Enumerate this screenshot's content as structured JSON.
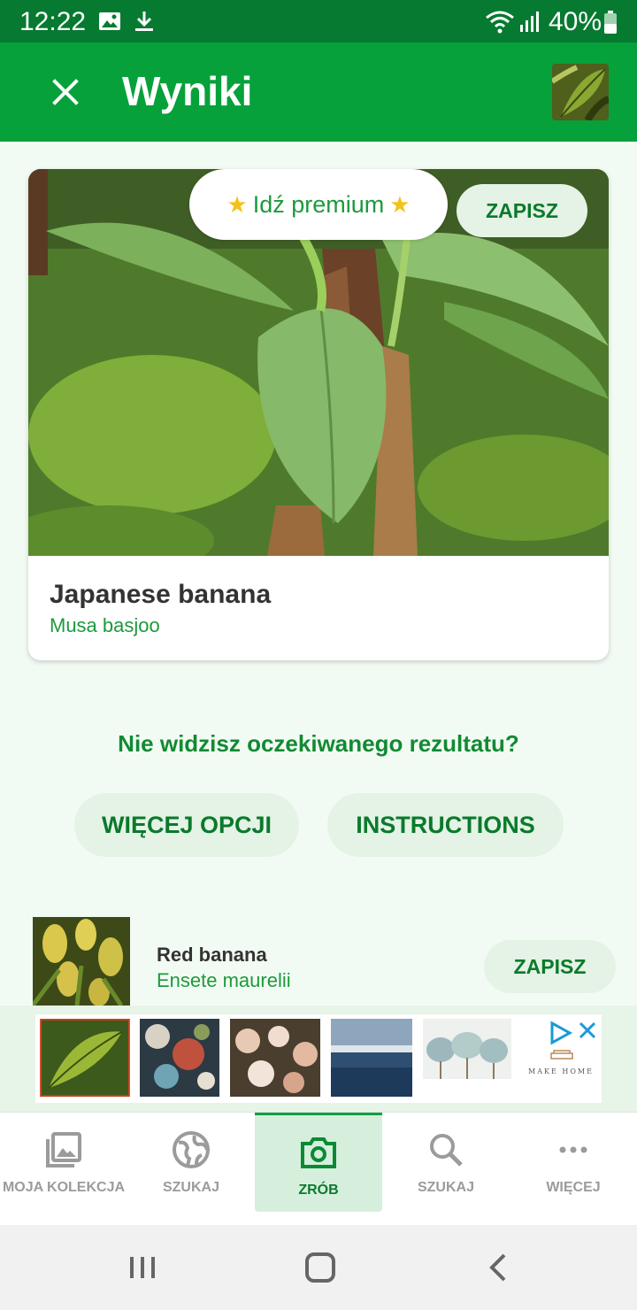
{
  "status_bar": {
    "time": "12:22",
    "battery": "40%"
  },
  "app_bar": {
    "title": "Wyniki"
  },
  "main_result": {
    "premium_label": "Idź premium",
    "save_label": "ZAPISZ",
    "common_name": "Japanese banana",
    "latin_name": "Musa basjoo"
  },
  "not_found": {
    "question": "Nie widzisz oczekiwanego rezultatu?",
    "more_options_label": "WIĘCEJ OPCJI",
    "instructions_label": "INSTRUCTIONS"
  },
  "second_result": {
    "common_name": "Red banana",
    "latin_name": "Ensete maurelii",
    "save_label": "ZAPISZ"
  },
  "ad": {
    "brand": "MAKE HOME"
  },
  "bottom_nav": {
    "items": [
      {
        "label": "MOJA KOLEKCJA",
        "icon": "collection-icon"
      },
      {
        "label": "SZUKAJ",
        "icon": "globe-icon"
      },
      {
        "label": "ZRÓB",
        "icon": "camera-icon"
      },
      {
        "label": "SZUKAJ",
        "icon": "search-icon"
      },
      {
        "label": "WIĘCEJ",
        "icon": "more-icon"
      }
    ],
    "active_index": 2
  },
  "colors": {
    "status_bar": "#067a30",
    "app_bar": "#06a13a",
    "accent_text": "#1d9a3c",
    "pill_bg": "#e4f3e6",
    "background": "#f2fbf3"
  }
}
